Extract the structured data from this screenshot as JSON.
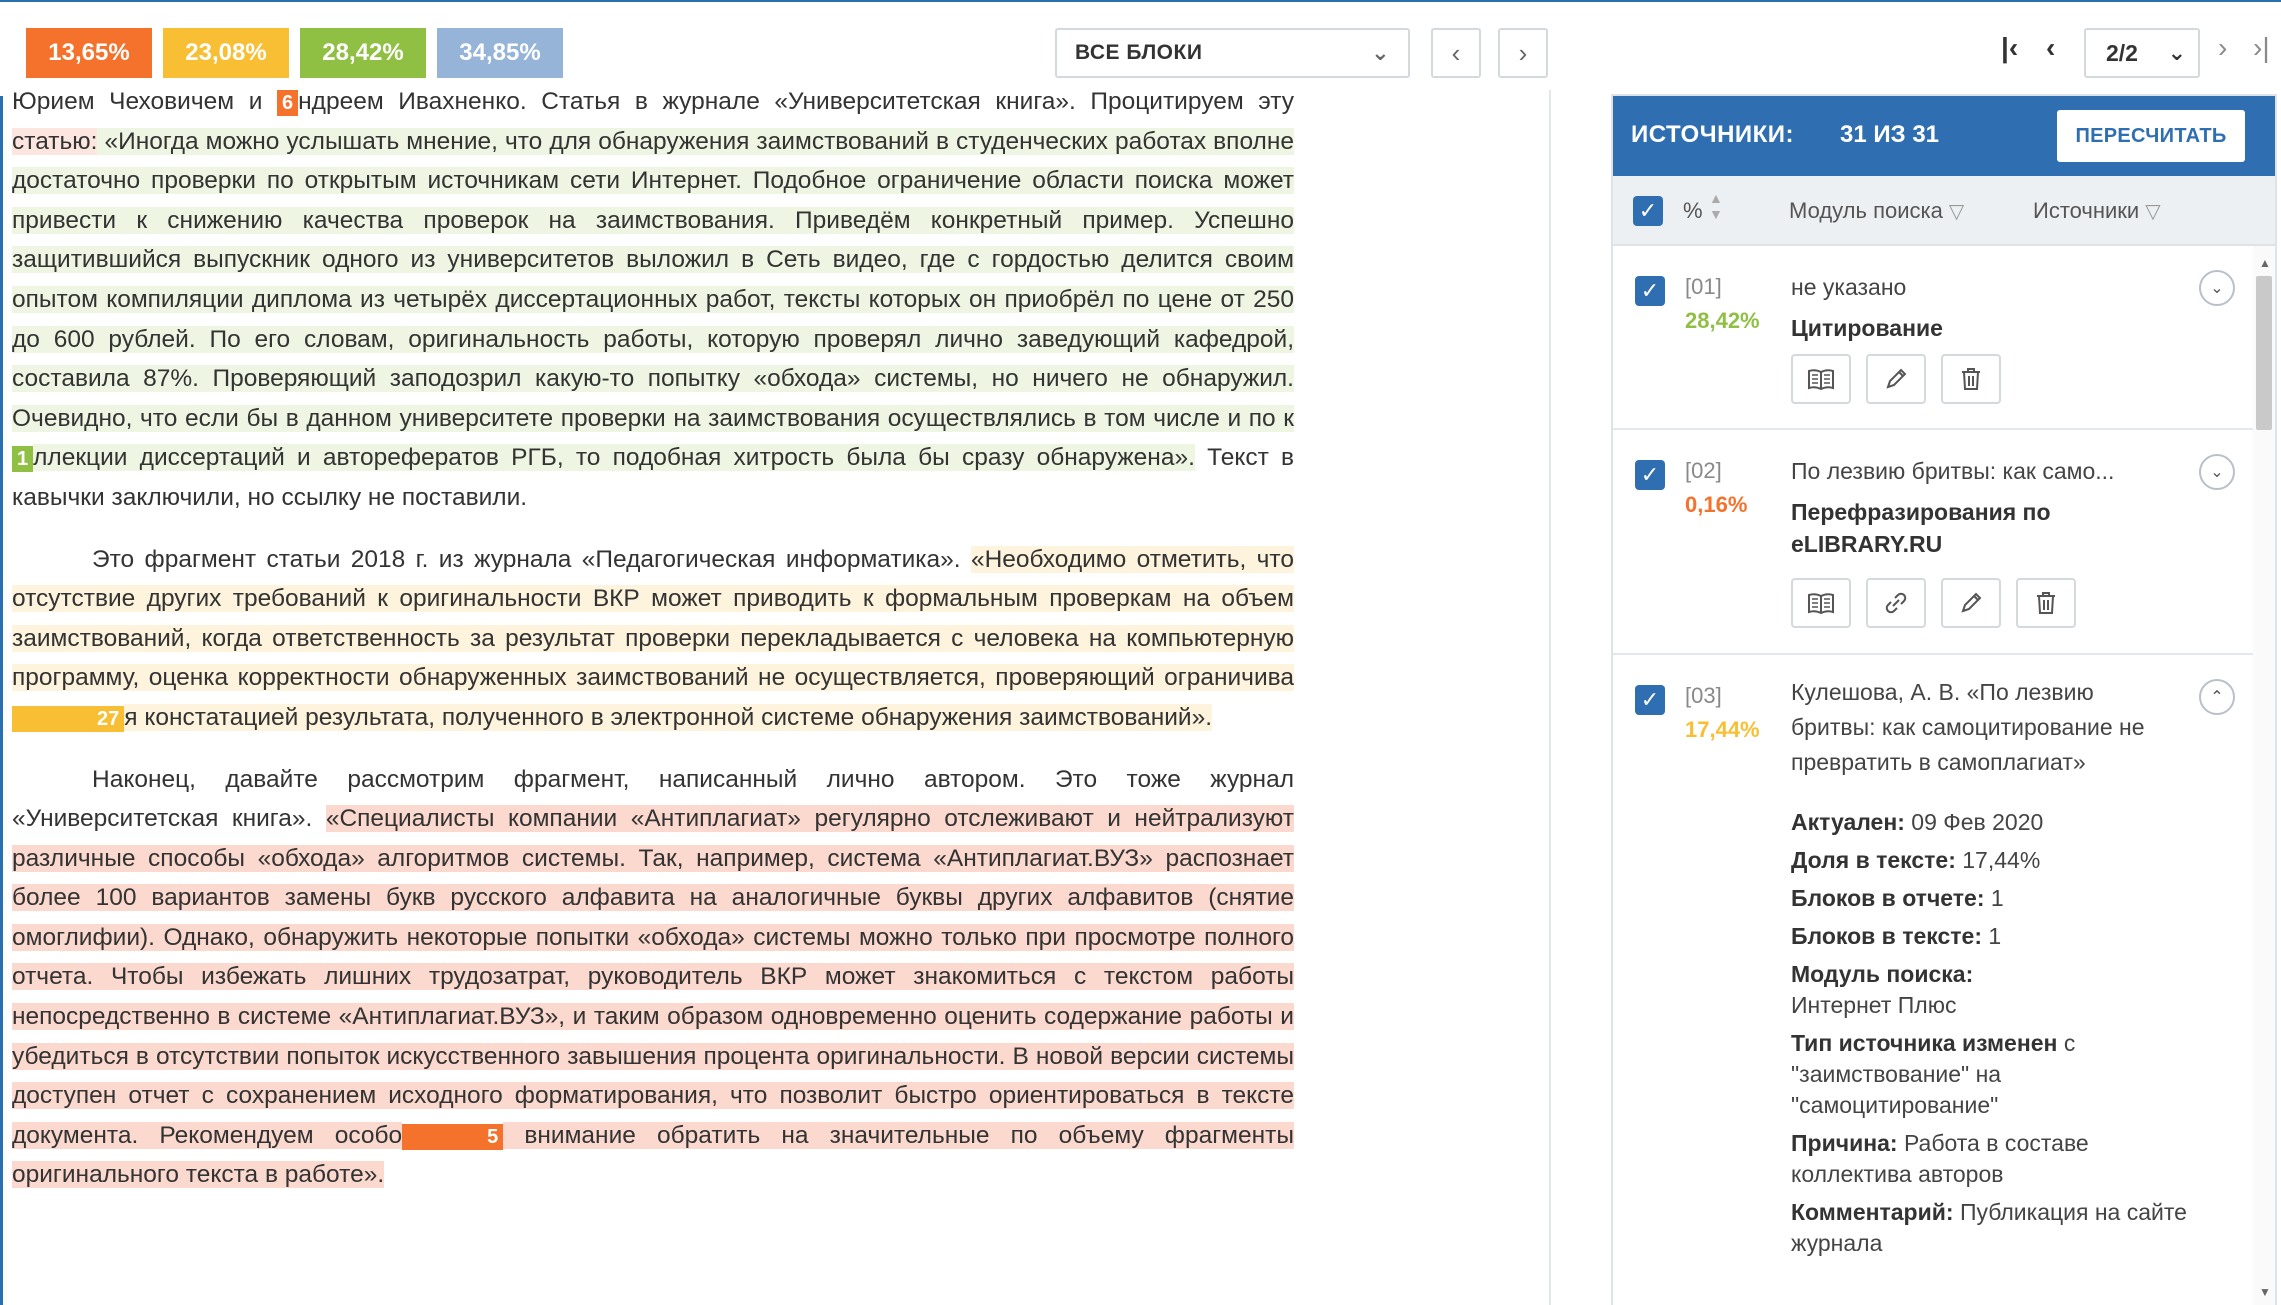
{
  "toolbar": {
    "badges": [
      {
        "label": "13,65%",
        "color": "#f4722b"
      },
      {
        "label": "23,08%",
        "color": "#f8bf35"
      },
      {
        "label": "28,42%",
        "color": "#8fc044"
      },
      {
        "label": "34,85%",
        "color": "#95b4d7"
      }
    ],
    "blocks_select": "ВСЕ БЛОКИ",
    "prev_icon": "chevron-left-icon",
    "next_icon": "chevron-right-icon",
    "page_select": "2/2",
    "first_icon": "first-page-icon",
    "last_icon": "last-page-icon"
  },
  "document": {
    "p1": {
      "lead": "Юрием Чеховичем и ",
      "marker_a": "6",
      "lead2": "ндреем Ивахненко. Статья в журнале «Университетская книга». Процитируем эту ",
      "word": "статью:",
      "quote_a": " «Иногда можно услышать мнение, что для обнаружения заимствований в студенческих работах вполне достаточно проверки по открытым источникам сети Интернет. Подобное ограничение области поиска может привести к снижению качества проверок на заимствования. Приведём конкретный пример. Успешно защитившийся выпускник одного из университетов выложил в Сеть видео, где с гордостью делится своим опытом компиляции диплома из четырёх диссертационных работ, тексты которых он приобрёл по цене от 250 до 600 рублей. По его словам, оригинальность работы, которую проверял лично заведующий кафедрой, составила 87%. Проверяющий заподозрил какую-то попытку «обхода» системы, но ничего не обнаружил. Очевидно, что если бы в данном университете проверки на заимствования осуществлялись в том числе и по к",
      "marker_b": "1",
      "quote_b": "ллекции диссертаций и авторефератов РГБ, то подобная хитрость была бы сразу обнаружена».",
      "tail": " Текст в кавычки заключили, но ссылку не поставили."
    },
    "p2": {
      "lead": "Это фрагмент статьи 2018 г. из журнала «Педагогическая информатика». ",
      "quote_a": "«Необходимо отметить, что отсутствие других требований к оригинальности ВКР может приводить к формальным проверкам на объем заимствований, когда ответственность за результат проверки перекладывается с человека на компьютерную программу, оценка корректности обнаруженных заимствований не осуществляется, проверяющий ограничива",
      "marker": "27",
      "quote_b": "я констатацией результата, полученного в электронной системе обнаружения заимствований»."
    },
    "p3": {
      "lead": "Наконец, давайте рассмотрим фрагмент, написанный лично автором. Это тоже журнал «Университетская книга». ",
      "quote_a": "«Специалисты компании «Антиплагиат» регулярно отслеживают и нейтрализуют различные способы «обхода» алгоритмов системы. Так, например, система «Антиплагиат.ВУЗ» распознает более 100 вариантов замены букв русского алфавита на аналогичные буквы других алфавитов (снятие омоглифии). Однако, обнаружить некоторые попытки «обхода» системы можно только при просмотре полного отчета. Чтобы избежать лишних трудозатрат, руководитель ВКР может знакомиться с текстом работы непосредственно в системе «Антиплагиат.ВУЗ», и таким образом одновременно оценить содержание работы и убедиться в отсутствии попыток искусственного завышения процента оригинальности. В новой версии системы доступен отчет с сохранением исходного форматирования, что позволит быстро ориентироваться в тексте документа. Рекомендуем особо",
      "marker": "5",
      "quote_b": " внимание обратить на значительные по объему фрагменты оригинального текста в работе»."
    }
  },
  "panel": {
    "title": "ИСТОЧНИКИ:",
    "count": "31 ИЗ 31",
    "recalc": "ПЕРЕСЧИТАТЬ",
    "filter": {
      "percent": "%",
      "module": "Модуль поиска",
      "sources": "Источники"
    },
    "items": [
      {
        "num": "[01]",
        "percent": "28,42%",
        "percent_color": "#8fc044",
        "name": "не указано",
        "type": "Цитирование"
      },
      {
        "num": "[02]",
        "percent": "0,16%",
        "percent_color": "#f4722b",
        "name": "По лезвию бритвы: как само...",
        "type": "Перефразирования по eLIBRARY.RU"
      },
      {
        "num": "[03]",
        "percent": "17,44%",
        "percent_color": "#f8bf35",
        "name": "Кулешова, А. В. «По лезвию бритвы: как самоцитирование не превратить в самоплагиат»",
        "details": {
          "actual_label": "Актуален:",
          "actual_value": "09 Фев 2020",
          "share_label": "Доля в тексте:",
          "share_value": "17,44%",
          "blocks_report_label": "Блоков в отчете:",
          "blocks_report_value": "1",
          "blocks_text_label": "Блоков в тексте:",
          "blocks_text_value": "1",
          "module_label": "Модуль поиска:",
          "module_value": "Интернет Плюс",
          "changed_label": "Тип источника изменен",
          "changed_value": "с \"заимствование\" на \"самоцитирование\"",
          "reason_label": "Причина:",
          "reason_value": "Работа в составе коллектива авторов",
          "comment_label": "Комментарий:",
          "comment_value": "Публикация на сайте журнала"
        }
      }
    ]
  }
}
